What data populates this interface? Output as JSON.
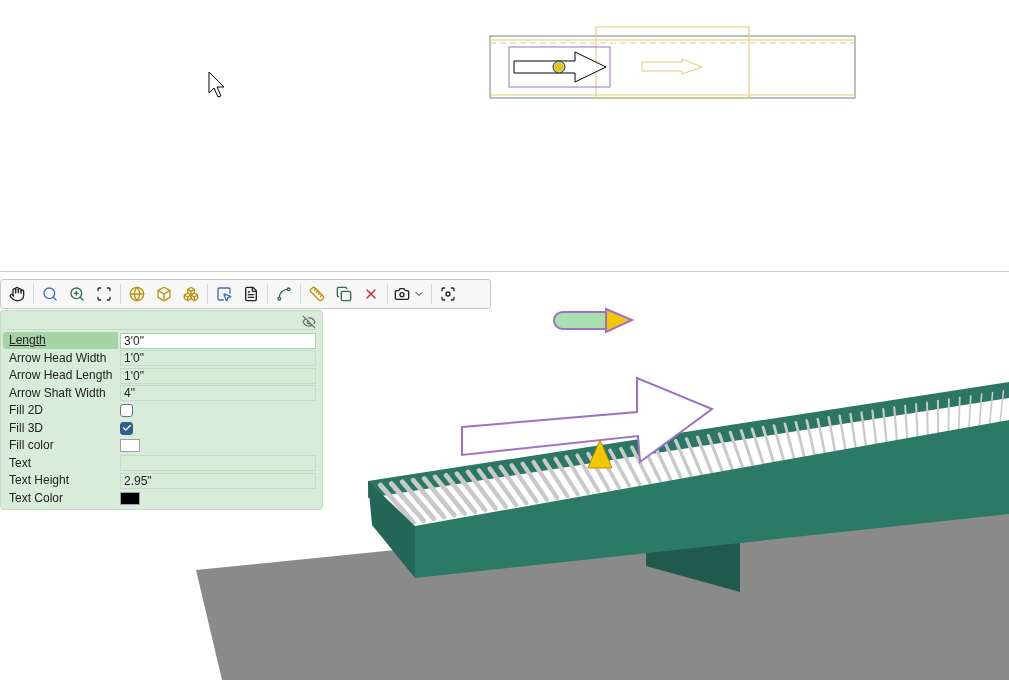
{
  "properties": [
    {
      "label": "Length",
      "kind": "text",
      "value": "3'0\"",
      "selected": true
    },
    {
      "label": "Arrow Head Width",
      "kind": "text",
      "value": "1'0\"",
      "selected": false
    },
    {
      "label": "Arrow Head Length",
      "kind": "text",
      "value": "1'0\"",
      "selected": false
    },
    {
      "label": "Arrow Shaft Width",
      "kind": "text",
      "value": "4\"",
      "selected": false
    },
    {
      "label": "Fill 2D",
      "kind": "checkbox",
      "checked": false,
      "selected": false
    },
    {
      "label": "Fill 3D",
      "kind": "checkbox",
      "checked": true,
      "selected": false
    },
    {
      "label": "Fill color",
      "kind": "color",
      "color": "#ffffff",
      "selected": false
    },
    {
      "label": "Text",
      "kind": "text",
      "selected": false
    },
    {
      "label": "Text Height",
      "kind": "text",
      "value": "2.95\"",
      "selected": false
    },
    {
      "label": "Text Color",
      "kind": "color",
      "color": "#000000",
      "selected": false
    }
  ]
}
